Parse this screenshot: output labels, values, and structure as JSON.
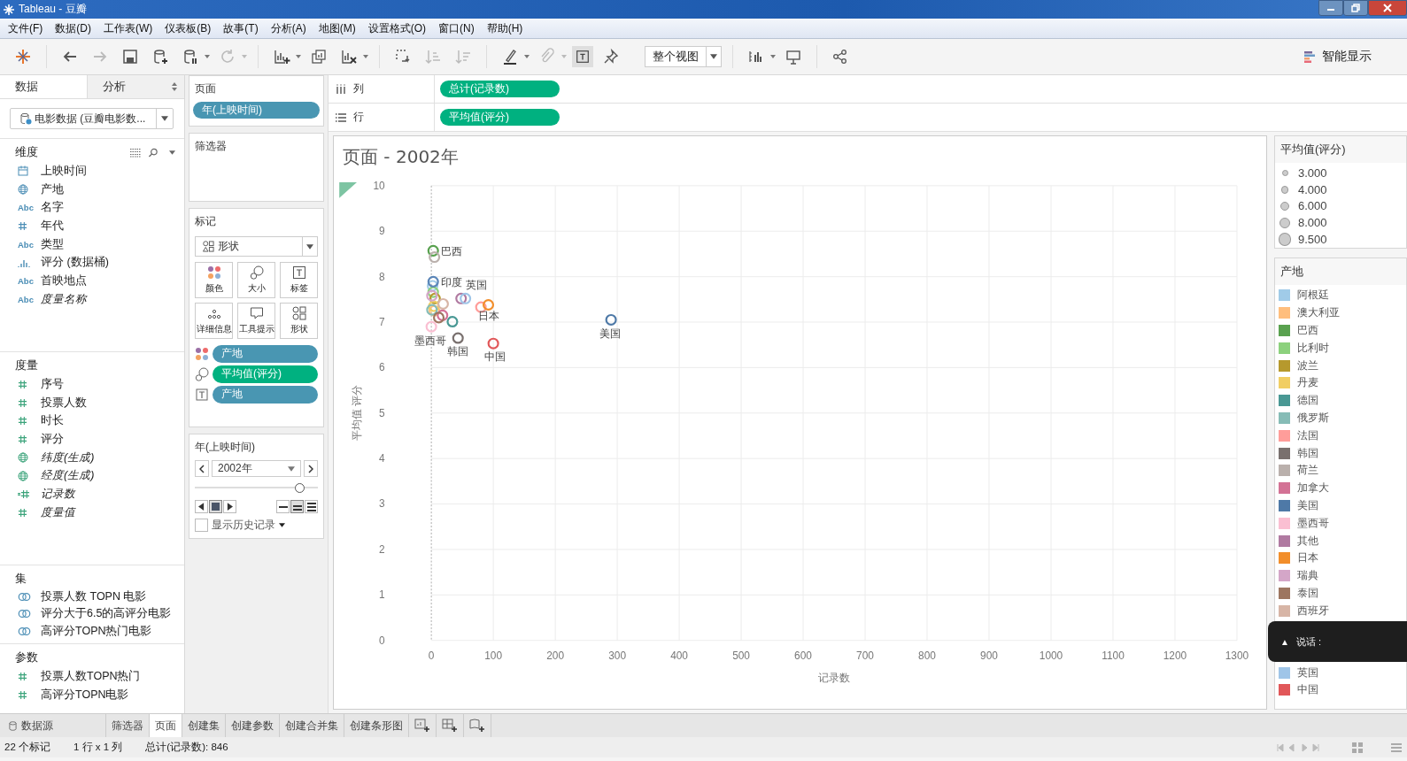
{
  "window": {
    "title": "Tableau - 豆瓣"
  },
  "menu": [
    "文件(F)",
    "数据(D)",
    "工作表(W)",
    "仪表板(B)",
    "故事(T)",
    "分析(A)",
    "地图(M)",
    "设置格式(O)",
    "窗口(N)",
    "帮助(H)"
  ],
  "toolbar": {
    "fit": "整个视图",
    "show_me": "智能显示",
    "mark_labels_on": true
  },
  "data_pane": {
    "tabs": [
      {
        "label": "数据",
        "selected": true
      },
      {
        "label": "分析",
        "selected": false
      }
    ],
    "datasource": "电影数据 (豆瓣电影数...",
    "sections": [
      {
        "title": "维度",
        "measure": false,
        "items": [
          {
            "label": "上映时间",
            "kind": "date",
            "italic": false
          },
          {
            "label": "产地",
            "kind": "geo",
            "italic": false
          },
          {
            "label": "名字",
            "kind": "text",
            "badge": "Abc",
            "italic": false
          },
          {
            "label": "年代",
            "kind": "number",
            "italic": false
          },
          {
            "label": "类型",
            "kind": "text",
            "badge": "Abc",
            "italic": false
          },
          {
            "label": "评分 (数据桶)",
            "kind": "bin",
            "italic": false
          },
          {
            "label": "首映地点",
            "kind": "text",
            "badge": "Abc",
            "italic": false
          },
          {
            "label": "度量名称",
            "kind": "text",
            "badge": "Abc",
            "italic": true
          }
        ]
      },
      {
        "title": "度量",
        "measure": true,
        "items": [
          {
            "label": "序号",
            "kind": "number",
            "italic": false
          },
          {
            "label": "投票人数",
            "kind": "number",
            "italic": false
          },
          {
            "label": "时长",
            "kind": "number",
            "italic": false
          },
          {
            "label": "评分",
            "kind": "number",
            "italic": false
          },
          {
            "label": "纬度(生成)",
            "kind": "geo",
            "italic": true
          },
          {
            "label": "经度(生成)",
            "kind": "geo",
            "italic": true
          },
          {
            "label": "记录数",
            "kind": "count",
            "italic": true
          },
          {
            "label": "度量值",
            "kind": "number",
            "italic": true
          }
        ]
      },
      {
        "title": "集",
        "measure": false,
        "items": [
          {
            "label": "投票人数 TOPN 电影",
            "kind": "set",
            "italic": false
          },
          {
            "label": "评分大于6.5的高评分电影",
            "kind": "set",
            "italic": false
          },
          {
            "label": "高评分TOPN热门电影",
            "kind": "set",
            "italic": false
          }
        ]
      },
      {
        "title": "参数",
        "measure": true,
        "items": [
          {
            "label": "投票人数TOPN热门",
            "kind": "number",
            "italic": false
          },
          {
            "label": "高评分TOPN电影",
            "kind": "number",
            "italic": false
          }
        ]
      }
    ]
  },
  "pages": {
    "title": "页面",
    "pills": [
      {
        "label": "年(上映时间)",
        "measure": false
      }
    ]
  },
  "filters": {
    "title": "筛选器"
  },
  "marks": {
    "title": "标记",
    "mark_type": "形状",
    "buttons": [
      {
        "label": "颜色",
        "kind": "color"
      },
      {
        "label": "大小",
        "kind": "size"
      },
      {
        "label": "标签",
        "kind": "label"
      },
      {
        "label": "详细信息",
        "kind": "detail"
      },
      {
        "label": "工具提示",
        "kind": "tooltip"
      },
      {
        "label": "形状",
        "kind": "shape"
      }
    ],
    "pills": [
      {
        "label": "产地",
        "measure": false,
        "kind": "color"
      },
      {
        "label": "平均值(评分)",
        "measure": true,
        "kind": "size"
      },
      {
        "label": "产地",
        "measure": false,
        "kind": "label"
      }
    ]
  },
  "page_control": {
    "title": "年(上映时间)",
    "value": "2002年",
    "level": 0.85,
    "history": {
      "label": "显示历史记录",
      "checked": false
    }
  },
  "columns_shelf": {
    "label": "列",
    "pills": [
      {
        "label": "总计(记录数)",
        "measure": true
      }
    ]
  },
  "rows_shelf": {
    "label": "行",
    "pills": [
      {
        "label": "平均值(评分)",
        "measure": true
      }
    ]
  },
  "view": {
    "title": "页面 - 2002年",
    "chart_data": {
      "type": "scatter",
      "xlabel": "记录数",
      "ylabel": "平均值 评分",
      "xlim": [
        0,
        1300
      ],
      "ylim": [
        0,
        10
      ],
      "xticks": [
        {
          "value": 0,
          "label": "0"
        },
        {
          "value": 100,
          "label": "100"
        },
        {
          "value": 200,
          "label": "200"
        },
        {
          "value": 300,
          "label": "300"
        },
        {
          "value": 400,
          "label": "400"
        },
        {
          "value": 500,
          "label": "500"
        },
        {
          "value": 600,
          "label": "600"
        },
        {
          "value": 700,
          "label": "700"
        },
        {
          "value": 800,
          "label": "800"
        },
        {
          "value": 900,
          "label": "900"
        },
        {
          "value": 1000,
          "label": "1000"
        },
        {
          "value": 1100,
          "label": "1100"
        },
        {
          "value": 1200,
          "label": "1200"
        },
        {
          "value": 1300,
          "label": "1300"
        }
      ],
      "yticks": [
        {
          "value": 0,
          "label": "0"
        },
        {
          "value": 1,
          "label": "1"
        },
        {
          "value": 2,
          "label": "2"
        },
        {
          "value": 3,
          "label": "3"
        },
        {
          "value": 4,
          "label": "4"
        },
        {
          "value": 5,
          "label": "5"
        },
        {
          "value": 6,
          "label": "6"
        },
        {
          "value": 7,
          "label": "7"
        },
        {
          "value": 8,
          "label": "8"
        },
        {
          "value": 9,
          "label": "9"
        },
        {
          "value": 10,
          "label": "10"
        }
      ],
      "grid": true,
      "series": [
        {
          "name": "阿根廷",
          "color": "#a0cbe8",
          "x": [
            2
          ],
          "values": [
            7.8
          ],
          "value_labels": [
            null
          ]
        },
        {
          "name": "澳大利亚",
          "color": "#ffbe7d",
          "x": [
            5
          ],
          "values": [
            7.25
          ],
          "value_labels": [
            null
          ]
        },
        {
          "name": "巴西",
          "color": "#59a14f",
          "x": [
            3
          ],
          "values": [
            8.57
          ],
          "value_labels": [
            "巴西"
          ]
        },
        {
          "name": "比利时",
          "color": "#8cd17d",
          "x": [
            3
          ],
          "values": [
            7.66
          ],
          "value_labels": [
            null
          ]
        },
        {
          "name": "波兰",
          "color": "#b6992d",
          "x": [
            6
          ],
          "values": [
            7.52
          ],
          "value_labels": [
            null
          ]
        },
        {
          "name": "丹麦",
          "color": "#f1ce63",
          "x": [
            4
          ],
          "values": [
            7.35
          ],
          "value_labels": [
            null
          ]
        },
        {
          "name": "德国",
          "color": "#499894",
          "x": [
            34
          ],
          "values": [
            7.01
          ],
          "value_labels": [
            null
          ]
        },
        {
          "name": "俄罗斯",
          "color": "#86bcb6",
          "x": [
            1
          ],
          "values": [
            7.27
          ],
          "value_labels": [
            null
          ]
        },
        {
          "name": "法国",
          "color": "#ff9d9a",
          "x": [
            80
          ],
          "values": [
            7.33
          ],
          "value_labels": [
            null
          ]
        },
        {
          "name": "韩国",
          "color": "#79706e",
          "x": [
            43
          ],
          "values": [
            6.65
          ],
          "value_labels": [
            "韩国"
          ]
        },
        {
          "name": "荷兰",
          "color": "#bab0ac",
          "x": [
            5
          ],
          "values": [
            8.43
          ],
          "value_labels": [
            null
          ]
        },
        {
          "name": "加拿大",
          "color": "#d37295",
          "x": [
            18
          ],
          "values": [
            7.15
          ],
          "value_labels": [
            null
          ]
        },
        {
          "name": "美国",
          "color": "#4e79a7",
          "x": [
            290
          ],
          "values": [
            7.05
          ],
          "value_labels": [
            "美国"
          ]
        },
        {
          "name": "墨西哥",
          "color": "#fabfd2",
          "x": [
            0
          ],
          "values": [
            6.9
          ],
          "value_labels": [
            "墨西哥"
          ]
        },
        {
          "name": "其他",
          "color": "#b07aa1",
          "x": [
            48
          ],
          "values": [
            7.52
          ],
          "value_labels": [
            null
          ]
        },
        {
          "name": "日本",
          "color": "#f28e2b",
          "x": [
            92
          ],
          "values": [
            7.38
          ],
          "value_labels": [
            "日本"
          ]
        },
        {
          "name": "瑞典",
          "color": "#d4a6c8",
          "x": [
            1
          ],
          "values": [
            7.58
          ],
          "value_labels": [
            null
          ]
        },
        {
          "name": "泰国",
          "color": "#9d7660",
          "x": [
            12
          ],
          "values": [
            7.1
          ],
          "value_labels": [
            null
          ]
        },
        {
          "name": "西班牙",
          "color": "#d7b5a6",
          "x": [
            19
          ],
          "values": [
            7.4
          ],
          "value_labels": [
            null
          ]
        },
        {
          "name": "印度",
          "color": "#5b86b8",
          "x": [
            3
          ],
          "values": [
            7.89
          ]
        },
        {
          "name": "英国",
          "color": "#9fc5e8",
          "x": [
            55
          ],
          "values": [
            7.52
          ],
          "value_labels": [
            "英国"
          ]
        },
        {
          "name": "中国",
          "color": "#e15759",
          "x": [
            100
          ],
          "values": [
            6.53
          ],
          "value_labels": [
            "中国"
          ]
        }
      ]
    }
  },
  "size_legend": {
    "title": "平均值(评分)",
    "items": [
      "3.000",
      "4.000",
      "6.000",
      "8.000",
      "9.500"
    ]
  },
  "color_legend": {
    "title": "产地"
  },
  "speech_bubble": {
    "icon": "▲",
    "text": "说话 :"
  },
  "sheet_tabs": [
    {
      "label": "数据源",
      "kind": "datasource",
      "selected": false
    },
    {
      "label": "筛选器",
      "kind": "sheet",
      "selected": false
    },
    {
      "label": "页面",
      "kind": "sheet",
      "selected": true
    },
    {
      "label": "创建集",
      "kind": "sheet",
      "selected": false
    },
    {
      "label": "创建参数",
      "kind": "sheet",
      "selected": false
    },
    {
      "label": "创建合并集",
      "kind": "sheet",
      "selected": false
    },
    {
      "label": "创建条形图",
      "kind": "sheet",
      "selected": false
    }
  ],
  "status_bar": [
    "22 个标记",
    "1 行 x 1 列",
    "总计(记录数): 846"
  ]
}
